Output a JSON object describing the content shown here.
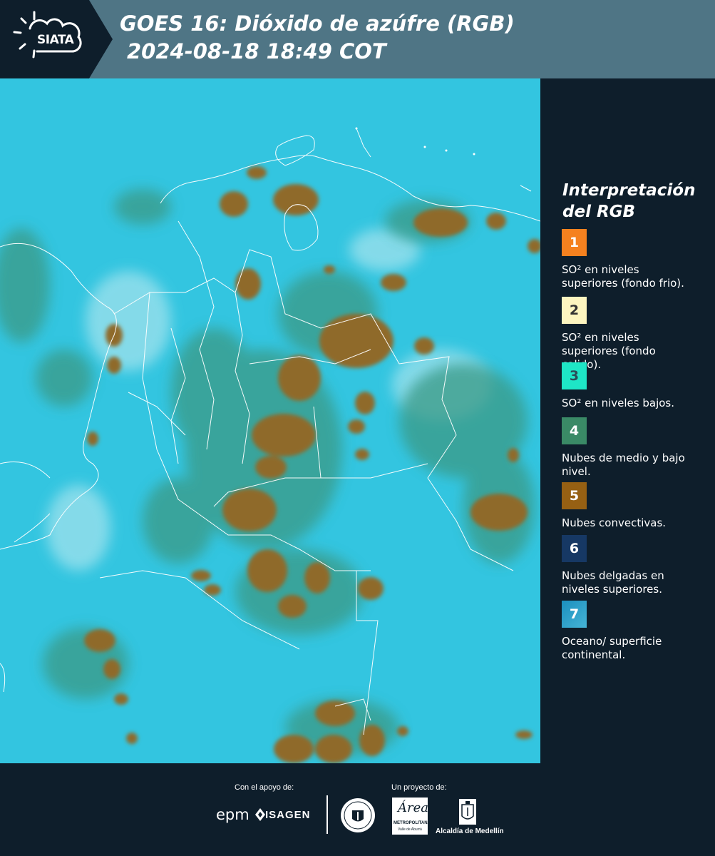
{
  "header": {
    "logo_text": "SIATA",
    "title_line1": "GOES 16: Dióxido de azúfre (RGB)",
    "title_line2": "2024-08-18 18:49 COT"
  },
  "legend": {
    "title": "Interpretación del RGB",
    "items": [
      {
        "number": "1",
        "color": "#f5811f",
        "text_color": "#ffffff",
        "label": "SO² en niveles superiores (fondo frio)."
      },
      {
        "number": "2",
        "color": "#fdf5c0",
        "text_color": "#333333",
        "label": "SO² en niveles superiores (fondo calido)."
      },
      {
        "number": "3",
        "color": "#1ee6c6",
        "text_color": "#2b4d58",
        "label": "SO² en niveles bajos."
      },
      {
        "number": "4",
        "color": "#3a8a66",
        "text_color": "#ffffff",
        "label": "Nubes de medio y bajo nivel."
      },
      {
        "number": "5",
        "color": "#966013",
        "text_color": "#ffffff",
        "label": "Nubes convectivas."
      },
      {
        "number": "6",
        "color": "#163864",
        "text_color": "#ffffff",
        "label": "Nubes delgadas en niveles superiores."
      },
      {
        "number": "7",
        "color": "#1b8fbe",
        "text_color": "#ffffff",
        "label": "Oceano/ superficie continental."
      }
    ]
  },
  "footer": {
    "support_label": "Con el apoyo de:",
    "project_label": "Un proyecto de:",
    "sponsor_epm": "epm",
    "sponsor_isagen": "ISAGEN",
    "alcaldia_label": "Alcaldía de Medellín"
  },
  "colors": {
    "background_ocean": "#33c5e0",
    "convective_cloud": "#8f6a2b",
    "low_cloud": "#3d9a88",
    "borders": "#ffffff"
  }
}
